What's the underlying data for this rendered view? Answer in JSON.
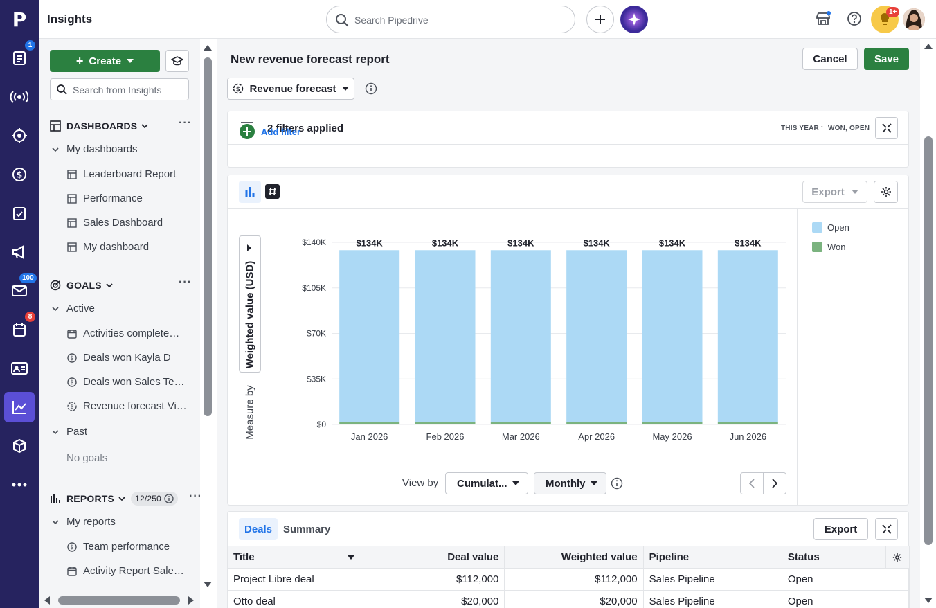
{
  "app": {
    "title": "Insights",
    "logo": "P"
  },
  "colors": {
    "rail": "#26235f",
    "accent_green": "#2b8040",
    "open": "#acd9f5",
    "won": "#7bb37f",
    "link": "#2174e8"
  },
  "rail": {
    "badges": {
      "activities": "1",
      "mail": "100",
      "calendar": "8"
    }
  },
  "topbar": {
    "search_placeholder": "Search Pipedrive",
    "notif_badge": "1+"
  },
  "sidebar": {
    "create_label": "Create",
    "search_placeholder": "Search from Insights",
    "dashboards": {
      "title": "DASHBOARDS",
      "group": "My dashboards",
      "items": [
        "Leaderboard Report",
        "Performance",
        "Sales Dashboard",
        "My dashboard"
      ]
    },
    "goals": {
      "title": "GOALS",
      "active_group": "Active",
      "active_items": [
        "Activities complete…",
        "Deals won Kayla D",
        "Deals won Sales Te…",
        "Revenue forecast Vi…"
      ],
      "past_group": "Past",
      "past_empty": "No goals"
    },
    "reports": {
      "title": "REPORTS",
      "count": "12/250",
      "group": "My reports",
      "items": [
        "Team performance",
        "Activity Report Sale…"
      ]
    }
  },
  "report": {
    "title": "New revenue forecast report",
    "cancel_label": "Cancel",
    "save_label": "Save",
    "type_label": "Revenue forecast",
    "filters_text": "2 filters applied",
    "filters_meta": [
      "THIS YEAR",
      "WON, OPEN"
    ],
    "add_filter": "Add filter",
    "export_label": "Export",
    "measure_prefix": "Measure by",
    "measure_value": "Weighted value (USD)",
    "view_by_label": "View by",
    "view_by_value": "Cumulat...",
    "interval_value": "Monthly"
  },
  "chart_data": {
    "type": "bar",
    "stacked": true,
    "categories": [
      "Jan 2026",
      "Feb 2026",
      "Mar 2026",
      "Apr 2026",
      "May 2026",
      "Jun 2026"
    ],
    "series": [
      {
        "name": "Open",
        "color": "#acd9f5",
        "values": [
          132000,
          132000,
          132000,
          132000,
          132000,
          132000
        ]
      },
      {
        "name": "Won",
        "color": "#7bb37f",
        "values": [
          2000,
          2000,
          2000,
          2000,
          2000,
          2000
        ]
      }
    ],
    "data_labels": [
      "$134K",
      "$134K",
      "$134K",
      "$134K",
      "$134K",
      "$134K"
    ],
    "ylabel": "Weighted value (USD)",
    "yticks": [
      "$0",
      "$35K",
      "$70K",
      "$105K",
      "$140K"
    ],
    "ytick_values": [
      0,
      35000,
      70000,
      105000,
      140000
    ],
    "ylim": [
      0,
      140000
    ],
    "grid": true,
    "legend_position": "right"
  },
  "table": {
    "tabs": [
      "Deals",
      "Summary"
    ],
    "export_label": "Export",
    "columns": [
      "Title",
      "Deal value",
      "Weighted value",
      "Pipeline",
      "Status"
    ],
    "rows": [
      [
        "Project Libre deal",
        "$112,000",
        "$112,000",
        "Sales Pipeline",
        "Open"
      ],
      [
        "Otto deal",
        "$20,000",
        "$20,000",
        "Sales Pipeline",
        "Open"
      ]
    ]
  }
}
